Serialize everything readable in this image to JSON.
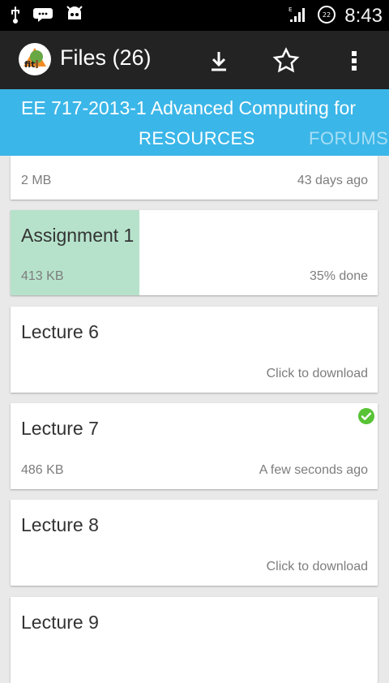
{
  "status_bar": {
    "time": "8:43",
    "icons": [
      "usb-icon",
      "chat-icon",
      "android-icon",
      "signal-icon",
      "battery-icon"
    ]
  },
  "app_bar": {
    "title": "Files (26)",
    "actions": [
      "download-icon",
      "star-icon",
      "overflow-menu-icon"
    ]
  },
  "course": {
    "title": "EE 717-2013-1 Advanced Computing for",
    "tabs": [
      "RESOURCES",
      "FORUMS"
    ]
  },
  "files": [
    {
      "title": "",
      "left": "2 MB",
      "right": "43 days ago"
    },
    {
      "title": "Assignment 1",
      "left": "413 KB",
      "right": "35% done",
      "progress": 0.35
    },
    {
      "title": "Lecture 6",
      "left": "",
      "right": "Click to download"
    },
    {
      "title": "Lecture 7",
      "left": "486 KB",
      "right": "A few seconds ago",
      "status_icon": "check-circle-icon"
    },
    {
      "title": "Lecture 8",
      "left": "",
      "right": "Click to download"
    },
    {
      "title": "Lecture 9",
      "left": "",
      "right": ""
    }
  ],
  "colors": {
    "status_bar": "#000000",
    "action_bar": "#232323",
    "header": "#3bb6e8",
    "progress": "#b6e2cb",
    "background": "#e9e9e9",
    "check": "#58c335"
  }
}
